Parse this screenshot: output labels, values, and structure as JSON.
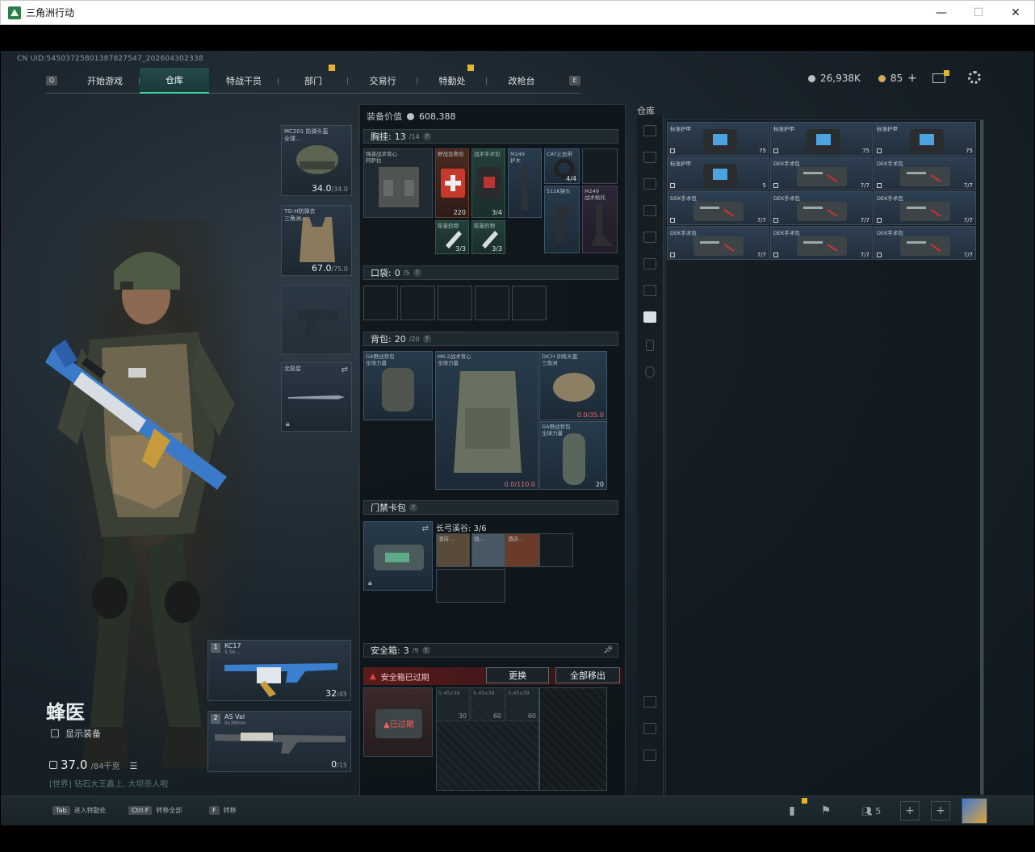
{
  "window": {
    "title": "三角洲行动",
    "min": "—",
    "max": "☐",
    "close": "✕"
  },
  "uid": "CN UID:5450372580138782​7547_202604302338",
  "nav": {
    "key_left": "Q",
    "key_right": "E",
    "tabs": [
      "开始游戏",
      "仓库",
      "特战干员",
      "部门",
      "交易行",
      "特勤处",
      "改枪台"
    ],
    "active_tab": "仓库"
  },
  "currency": {
    "silver": "26,938K",
    "gold": "85",
    "plus": "+"
  },
  "operator": {
    "name": "蜂医",
    "show_equip": "显示装备",
    "weight": "37.0",
    "weight_max": "/84千克",
    "quote": "[世界] 钻石大王鑫上, 大坝杀人啦"
  },
  "slots": {
    "helmet": {
      "label": "MC201 防弹头盔\n全球...",
      "durability": "34.0",
      "max": "/34.0"
    },
    "armor": {
      "label": "TG-H防弹衣\n三角洲...",
      "durability": "67.0",
      "max": "/75.0"
    },
    "melee": {
      "label": "北极星"
    },
    "primary": {
      "num": "1",
      "name": "KC17",
      "sub": "5.56...",
      "ammo": "32",
      "ammo_max": "/45"
    },
    "secondary": {
      "num": "2",
      "name": "AS Val",
      "sub": "9x39mm",
      "ammo": "0",
      "ammo_max": "/15"
    }
  },
  "mid": {
    "equip_value_label": "装备价值",
    "equip_value": "608,388",
    "chest": {
      "title": "胸挂:",
      "count": "13",
      "max": "/14"
    },
    "chest_items": [
      {
        "label": "强袭战术背心\n阿萨拉"
      },
      {
        "label": "野战急救包",
        "val": "220"
      },
      {
        "label": "战术手术包",
        "val": "3/4"
      },
      {
        "label": "M249\n护木"
      },
      {
        "label": "CAT止血带",
        "val": "4/4"
      },
      {
        "label": "512K镜头"
      },
      {
        "label": "M249\n战术枪托"
      },
      {
        "label": "眩晕药物",
        "val": "3/3"
      },
      {
        "label": "眩晕药物",
        "val": "3/3"
      }
    ],
    "pocket": {
      "title": "口袋:",
      "count": "0",
      "max": "/5"
    },
    "backpack": {
      "title": "背包:",
      "count": "20",
      "max": "/20"
    },
    "backpack_items": [
      {
        "label": "GA野战背包\n全球力量"
      },
      {
        "label": "MK-2战术背心\n全球力量",
        "val": "0.0/110.0"
      },
      {
        "label": "DICH 训练头盔\n三角洲",
        "val": "0.0/35.0"
      },
      {
        "label": "GA野战背包\n全球力量",
        "val": "20"
      }
    ],
    "keycard": {
      "title": "门禁卡包",
      "map": "长弓溪谷: 3/6",
      "items": [
        "酒店...",
        "钱...",
        "酒店..."
      ]
    },
    "safebox": {
      "title": "安全箱:",
      "count": "3",
      "max": "/9",
      "warning": "安全箱已过期",
      "replace": "更换",
      "move_all": "全部移出",
      "expired": "已过期",
      "items": [
        "5.45x39",
        "5.45x39",
        "5.45x39"
      ],
      "item_vals": [
        "30",
        "60",
        "60"
      ]
    }
  },
  "warehouse": {
    "title": "仓库",
    "items": [
      {
        "label": "标准护甲",
        "val": "75"
      },
      {
        "label": "标准护甲",
        "val": "75"
      },
      {
        "label": "标准护甲",
        "val": "75"
      },
      {
        "label": "标准护甲",
        "val": "5"
      },
      {
        "label": "DEK手术包",
        "val": "7/7"
      },
      {
        "label": "DEK手术包",
        "val": "7/7"
      },
      {
        "label": "DEK手术包",
        "val": "7/7"
      },
      {
        "label": "DEK手术包",
        "val": "7/7"
      },
      {
        "label": "DEK手术包",
        "val": "7/7"
      },
      {
        "label": "DEK手术包",
        "val": "7/7"
      },
      {
        "label": "DEK手术包",
        "val": "7/7"
      },
      {
        "label": "DEK手术包",
        "val": "7/7"
      }
    ]
  },
  "bottom": {
    "hints": [
      {
        "key": "Tab",
        "text": "进入特勤处"
      },
      {
        "key": "Ctrl F",
        "text": "转移全部"
      },
      {
        "key": "F",
        "text": "转移"
      }
    ],
    "friends": "5"
  }
}
